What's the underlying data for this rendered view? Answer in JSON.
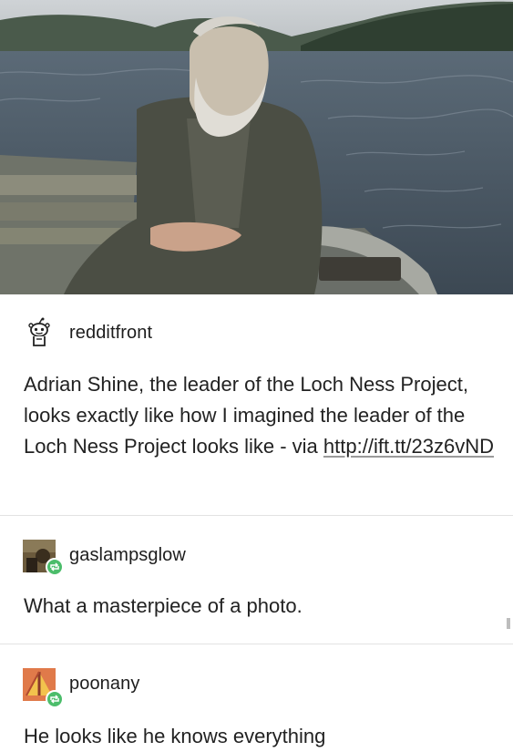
{
  "photo": {
    "alt_icon": "photo-image"
  },
  "posts": [
    {
      "username": "redditfront",
      "avatar_icon": "reddit-alien-icon",
      "text": "Adrian Shine, the leader of the Loch Ness Project, looks exactly like how I imagined the leader of the Loch Ness Project looks like - via",
      "link": "http://ift.tt/23z6vND"
    },
    {
      "username": "gaslampsglow",
      "avatar_icon": "user-avatar",
      "reblog_icon": "reblog-icon",
      "text": "What a masterpiece of a photo."
    },
    {
      "username": "poonany",
      "avatar_icon": "user-avatar",
      "reblog_icon": "reblog-icon",
      "text": "He looks like he knows everything"
    }
  ],
  "colors": {
    "reblog_badge": "#4cbd6b",
    "divider": "#e3e3e3"
  }
}
